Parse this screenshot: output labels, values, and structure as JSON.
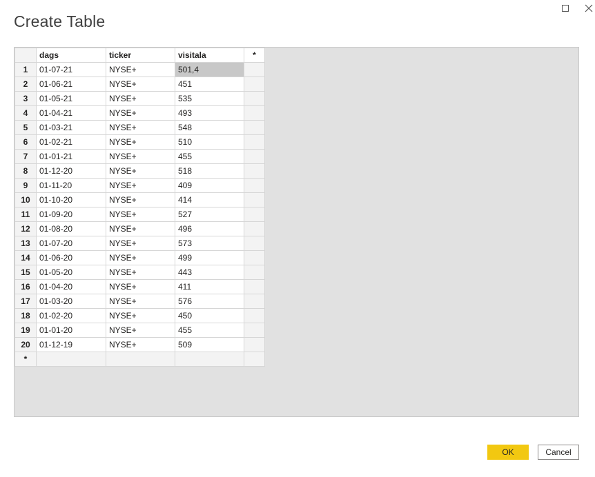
{
  "dialog": {
    "title": "Create Table"
  },
  "window_controls": {
    "maximize_icon": "maximize-icon",
    "close_icon": "close-icon"
  },
  "table": {
    "columns": [
      "dags",
      "ticker",
      "visitala"
    ],
    "new_column_marker": "*",
    "new_row_marker": "*",
    "selected_cell": {
      "row": 1,
      "column": "visitala"
    },
    "rows": [
      {
        "num": "1",
        "dags": "01-07-21",
        "ticker": "NYSE+",
        "visitala": "501,4"
      },
      {
        "num": "2",
        "dags": "01-06-21",
        "ticker": "NYSE+",
        "visitala": "451"
      },
      {
        "num": "3",
        "dags": "01-05-21",
        "ticker": "NYSE+",
        "visitala": "535"
      },
      {
        "num": "4",
        "dags": "01-04-21",
        "ticker": "NYSE+",
        "visitala": "493"
      },
      {
        "num": "5",
        "dags": "01-03-21",
        "ticker": "NYSE+",
        "visitala": "548"
      },
      {
        "num": "6",
        "dags": "01-02-21",
        "ticker": "NYSE+",
        "visitala": "510"
      },
      {
        "num": "7",
        "dags": "01-01-21",
        "ticker": "NYSE+",
        "visitala": "455"
      },
      {
        "num": "8",
        "dags": "01-12-20",
        "ticker": "NYSE+",
        "visitala": "518"
      },
      {
        "num": "9",
        "dags": "01-11-20",
        "ticker": "NYSE+",
        "visitala": "409"
      },
      {
        "num": "10",
        "dags": "01-10-20",
        "ticker": "NYSE+",
        "visitala": "414"
      },
      {
        "num": "11",
        "dags": "01-09-20",
        "ticker": "NYSE+",
        "visitala": "527"
      },
      {
        "num": "12",
        "dags": "01-08-20",
        "ticker": "NYSE+",
        "visitala": "496"
      },
      {
        "num": "13",
        "dags": "01-07-20",
        "ticker": "NYSE+",
        "visitala": "573"
      },
      {
        "num": "14",
        "dags": "01-06-20",
        "ticker": "NYSE+",
        "visitala": "499"
      },
      {
        "num": "15",
        "dags": "01-05-20",
        "ticker": "NYSE+",
        "visitala": "443"
      },
      {
        "num": "16",
        "dags": "01-04-20",
        "ticker": "NYSE+",
        "visitala": "411"
      },
      {
        "num": "17",
        "dags": "01-03-20",
        "ticker": "NYSE+",
        "visitala": "576"
      },
      {
        "num": "18",
        "dags": "01-02-20",
        "ticker": "NYSE+",
        "visitala": "450"
      },
      {
        "num": "19",
        "dags": "01-01-20",
        "ticker": "NYSE+",
        "visitala": "455"
      },
      {
        "num": "20",
        "dags": "01-12-19",
        "ticker": "NYSE+",
        "visitala": "509"
      }
    ]
  },
  "buttons": {
    "ok_label": "OK",
    "cancel_label": "Cancel"
  },
  "colors": {
    "ok_accent": "#f2c811",
    "grid_background": "#e1e1e1",
    "selected_cell": "#c8c8c8"
  }
}
